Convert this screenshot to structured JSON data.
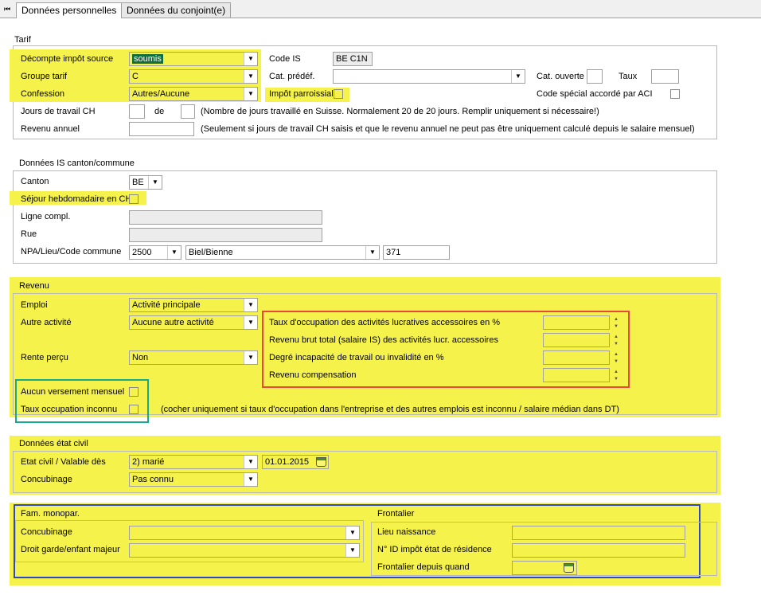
{
  "tabs": {
    "nav_icon": "first-page-arrow-icon",
    "items": [
      {
        "label": "Données personnelles",
        "active": true
      },
      {
        "label": "Données du conjoint(e)",
        "active": false
      }
    ]
  },
  "tarif": {
    "title": "Tarif",
    "decompte_label": "Décompte impôt source",
    "decompte_value": "soumis",
    "groupe_label": "Groupe tarif",
    "groupe_value": "C",
    "confession_label": "Confession",
    "confession_value": "Autres/Aucune",
    "code_is_label": "Code IS",
    "code_is_value": "BE C1N",
    "cat_predef_label": "Cat. prédéf.",
    "cat_predef_value": "",
    "cat_ouverte_label": "Cat. ouverte",
    "taux_label": "Taux",
    "impot_paroissial_label": "Impôt parroissial",
    "code_special_label": "Code spécial accordé par ACI",
    "jours_label": "Jours de travail CH",
    "de_label": "de",
    "jours_note": "(Nombre de jours travaillé en Suisse. Normalement 20 de 20 jours. Remplir uniquement si nécessaire!)",
    "revenu_annuel_label": "Revenu annuel",
    "revenu_note": "(Seulement si jours de travail CH saisis et que le revenu annuel ne peut pas être uniquement calculé depuis le salaire mensuel)"
  },
  "canton": {
    "title": "Données IS canton/commune",
    "canton_label": "Canton",
    "canton_value": "BE",
    "sejour_label": "Séjour hebdomadaire en CH",
    "ligne_label": "Ligne compl.",
    "rue_label": "Rue",
    "npa_label": "NPA/Lieu/Code commune",
    "npa_value": "2500",
    "lieu_value": "Biel/Bienne",
    "code_value": "371"
  },
  "revenu": {
    "title": "Revenu",
    "emploi_label": "Emploi",
    "emploi_value": "Activité principale",
    "autre_label": "Autre activité",
    "autre_value": "Aucune autre activité",
    "rente_label": "Rente perçu",
    "rente_value": "Non",
    "taux_occ_label": "Taux d'occupation des activités lucratives accessoires en %",
    "revenu_brut_label": "Revenu brut total (salaire IS) des activités lucr. accessoires",
    "degre_label": "Degré incapacité de travail ou invalidité en %",
    "compensation_label": "Revenu compensation",
    "aucun_versement_label": "Aucun versement mensuel",
    "taux_inconnu_label": "Taux occupation inconnu",
    "taux_inconnu_note": "(cocher uniquement si taux d'occupation dans l'entreprise et des autres emplois est inconnu  / salaire médian dans DT)"
  },
  "etat_civil": {
    "title": "Données état civil",
    "etat_label": "Etat civil / Valable dès",
    "etat_value": "2) marié",
    "date_value": "01.01.2015",
    "concubinage_label": "Concubinage",
    "concubinage_value": "Pas connu"
  },
  "fam": {
    "title": "Fam. monopar.",
    "concubinage_label": "Concubinage",
    "droit_label": "Droit garde/enfant majeur"
  },
  "frontalier": {
    "title": "Frontalier",
    "lieu_label": "Lieu naissance",
    "nid_label": "N° ID impôt état de résidence",
    "depuis_label": "Frontalier depuis quand"
  },
  "colors": {
    "highlight": "#f6f24c",
    "red_box": "#e8473a",
    "green_box": "#1aa88a",
    "blue_box": "#2c48c8"
  }
}
